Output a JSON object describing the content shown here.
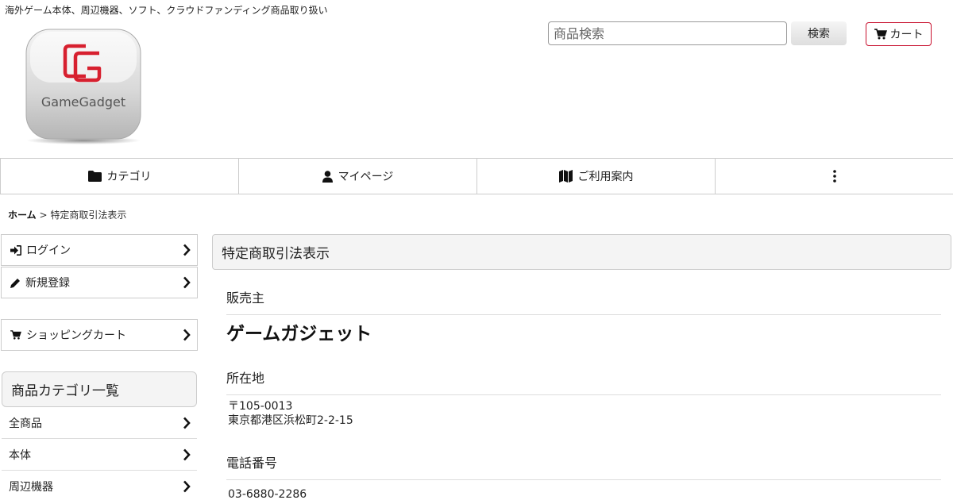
{
  "header": {
    "tagline": "海外ゲーム本体、周辺機器、ソフト、クラウドファンディング商品取り扱い",
    "logo_text": "GameGadget",
    "search_placeholder": "商品検索",
    "search_button": "検索",
    "cart_button": "カート",
    "brand_color": "#d7202f"
  },
  "nav": {
    "items": [
      {
        "label": "カテゴリ",
        "icon": "folder-icon"
      },
      {
        "label": "マイページ",
        "icon": "user-icon"
      },
      {
        "label": "ご利用案内",
        "icon": "map-icon"
      },
      {
        "label": "",
        "icon": "more-vertical-icon"
      }
    ]
  },
  "breadcrumb": {
    "home": "ホーム",
    "separator": ">",
    "current": "特定商取引法表示"
  },
  "sidebar": {
    "login": "ログイン",
    "register": "新規登録",
    "shopping_cart": "ショッピングカート",
    "category_title": "商品カテゴリ一覧",
    "categories": [
      "全商品",
      "本体",
      "周辺機器"
    ]
  },
  "main": {
    "title": "特定商取引法表示",
    "seller_label": "販売主",
    "seller_value": "ゲームガジェット",
    "address_label": "所在地",
    "postal": "〒105-0013",
    "address": "東京都港区浜松町2-2-15",
    "phone_label": "電話番号",
    "phone": "03-6880-2286"
  }
}
